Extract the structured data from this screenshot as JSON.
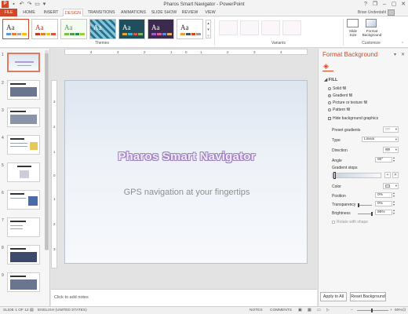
{
  "app": {
    "title": "Pharos Smart Navigator - PowerPoint",
    "user": "Brian Underdahl",
    "window_controls": [
      "?",
      "❐",
      "–",
      "▢",
      "✕"
    ]
  },
  "tabs": [
    "FILE",
    "HOME",
    "INSERT",
    "DESIGN",
    "TRANSITIONS",
    "ANIMATIONS",
    "SLIDE SHOW",
    "REVIEW",
    "VIEW"
  ],
  "active_tab": "DESIGN",
  "ribbon": {
    "themes_label": "Themes",
    "variants_label": "Variants",
    "customize_label": "Customize",
    "slide_size_label": "Slide\nSize",
    "format_bg_label": "Format\nBackground",
    "theme_glyph": "Aa"
  },
  "thumbnails": [
    "1",
    "2",
    "3",
    "4",
    "5",
    "6",
    "7",
    "8",
    "9"
  ],
  "slide": {
    "title": "Pharos Smart Navigator",
    "subtitle": "GPS navigation at your fingertips"
  },
  "ruler": {
    "h": [
      "4",
      "3",
      "2",
      "1",
      "0",
      "1",
      "2",
      "3",
      "4"
    ],
    "v": [
      "3",
      "2",
      "1",
      "0",
      "1",
      "2",
      "3"
    ]
  },
  "notes_placeholder": "Click to add notes",
  "format_pane": {
    "title": "Format Background",
    "section": "FILL",
    "options": [
      "Solid fill",
      "Gradient fill",
      "Picture or texture fill",
      "Pattern fill"
    ],
    "selected_option": "Gradient fill",
    "hide_graphics": "Hide background graphics",
    "preset_gradients": "Preset gradients",
    "type_label": "Type",
    "type_value": "Linear",
    "direction_label": "Direction",
    "angle_label": "Angle",
    "angle_value": "90°",
    "gradient_stops_label": "Gradient stops",
    "color_label": "Color",
    "position_label": "Position",
    "position_value": "0%",
    "transparency_label": "Transparency",
    "transparency_value": "0%",
    "brightness_label": "Brightness",
    "brightness_value": "95%",
    "rotate_label": "Rotate with shape",
    "apply_all": "Apply to All",
    "reset": "Reset Background"
  },
  "status": {
    "slide_of": "SLIDE 1 OF 12",
    "language": "ENGLISH (UNITED STATES)",
    "notes": "NOTES",
    "comments": "COMMENTS",
    "zoom": "60%"
  },
  "colors": {
    "accent": "#d24726",
    "title_outline": "#9d82c0"
  }
}
